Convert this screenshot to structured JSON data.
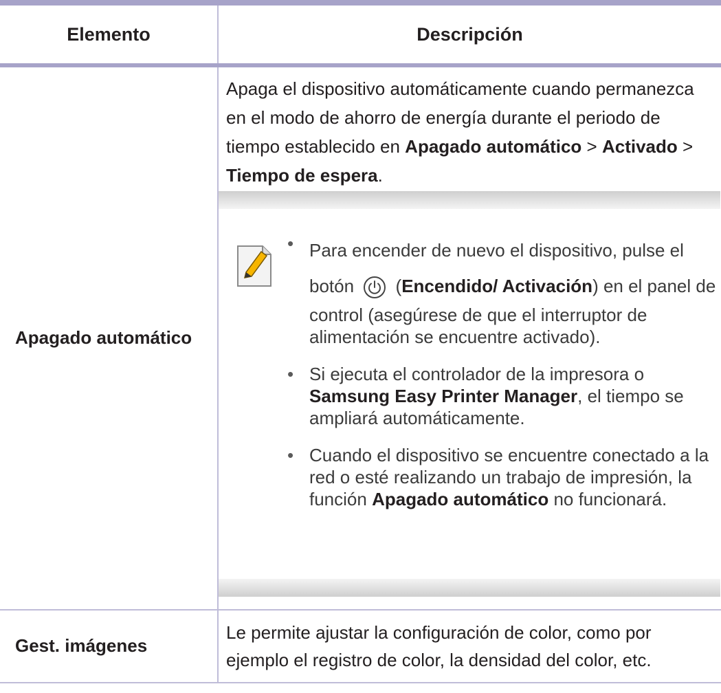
{
  "table": {
    "header": {
      "col1": "Elemento",
      "col2": "Descripción"
    },
    "row1": {
      "label": "Apagado automático",
      "para_text": "Apaga el dispositivo automáticamente cuando permanezca en el modo de ahorro de energía durante el periodo de tiempo establecido en ",
      "para_b1": "Apagado automático",
      "para_sep1": " > ",
      "para_b2": "Activado",
      "para_sep2": " > ",
      "para_b3": "Tiempo de espera",
      "para_end": ".",
      "note": {
        "icon": "note-pencil-icon",
        "bullet_glyph": "•",
        "bullet1_a": "Para encender de nuevo el dispositivo, pulse el botón ",
        "power_icon": "power-icon",
        "bullet1_b": " (",
        "bullet1_bold": "Encendido/ Activación",
        "bullet1_c": ") en el panel de control (asegúrese de que el interruptor de alimentación se encuentre activado).",
        "bullet2_a": "Si ejecuta el controlador de la impresora o ",
        "bullet2_bold": "Samsung Easy Printer Manager",
        "bullet2_b": ", el tiempo se ampliará automáticamente.",
        "bullet3_a": "Cuando el dispositivo se encuentre conectado a la red o esté realizando un trabajo de impresión, la función ",
        "bullet3_bold": "Apagado automático",
        "bullet3_b": " no funcionará."
      }
    },
    "row2": {
      "label": "Gest. imágenes",
      "desc": "Le permite ajustar la configuración de color, como por ejemplo el registro de color, la densidad del color, etc."
    }
  },
  "colors": {
    "rule": "#a7a3c9",
    "grid": "#bfbcd8",
    "text": "#231f20",
    "note_bar": "#cfcfcf"
  }
}
